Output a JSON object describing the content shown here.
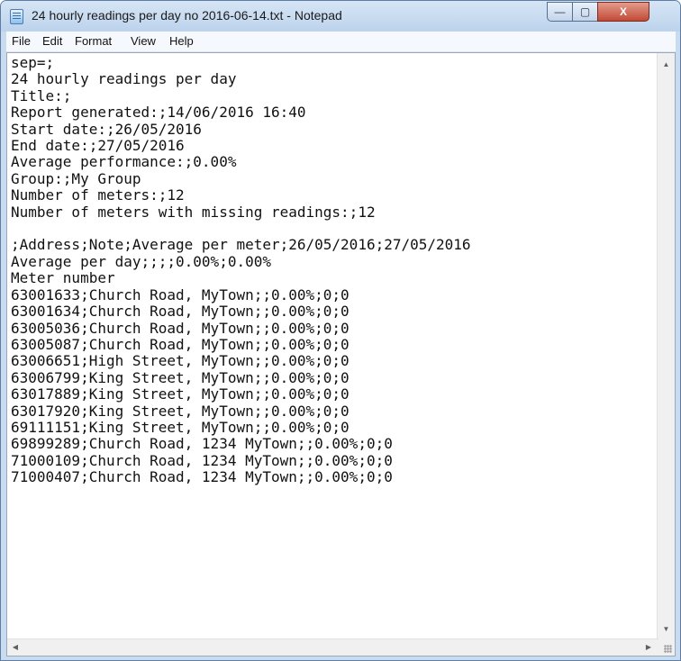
{
  "window": {
    "title": "24 hourly readings per day no 2016-06-14.txt - Notepad",
    "buttons": {
      "minimize": "—",
      "maximize": "▢",
      "close": "X"
    }
  },
  "menu": [
    "File",
    "Edit",
    "Format",
    "View",
    "Help"
  ],
  "document": {
    "text": "sep=;\n24 hourly readings per day\nTitle:;\nReport generated:;14/06/2016 16:40\nStart date:;26/05/2016\nEnd date:;27/05/2016\nAverage performance:;0.00%\nGroup:;My Group\nNumber of meters:;12\nNumber of meters with missing readings:;12\n\n;Address;Note;Average per meter;26/05/2016;27/05/2016\nAverage per day;;;;0.00%;0.00%\nMeter number\n63001633;Church Road, MyTown;;0.00%;0;0\n63001634;Church Road, MyTown;;0.00%;0;0\n63005036;Church Road, MyTown;;0.00%;0;0\n63005087;Church Road, MyTown;;0.00%;0;0\n63006651;High Street, MyTown;;0.00%;0;0\n63006799;King Street, MyTown;;0.00%;0;0\n63017889;King Street, MyTown;;0.00%;0;0\n63017920;King Street, MyTown;;0.00%;0;0\n69111151;King Street, MyTown;;0.00%;0;0\n69899289;Church Road, 1234 MyTown;;0.00%;0;0\n71000109;Church Road, 1234 MyTown;;0.00%;0;0\n71000407;Church Road, 1234 MyTown;;0.00%;0;0"
  },
  "icons": {
    "app": "notepad-icon",
    "scroll_up": "▲",
    "scroll_down": "▼",
    "scroll_left": "◀",
    "scroll_right": "▶"
  },
  "colors": {
    "frame": "#c9dbee",
    "close_button": "#c24a36",
    "menu_background": "#f5f8fc"
  }
}
